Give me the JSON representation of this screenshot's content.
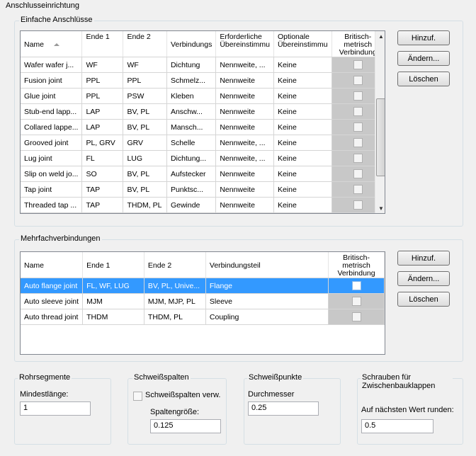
{
  "title": "Anschlusseinrichtung",
  "simple": {
    "title": "Einfache Anschlüsse",
    "columns": [
      "Name",
      "Ende 1",
      "Ende 2",
      "Verbindungs",
      "Erforderliche Übereinstimmu",
      "Optionale Übereinstimmu",
      "Britisch-metrisch Verbindung"
    ],
    "rows": [
      [
        "Wafer wafer j...",
        "WF",
        "WF",
        "Dichtung",
        "Nennweite, ...",
        "Keine"
      ],
      [
        "Fusion joint",
        "PPL",
        "PPL",
        "Schmelz...",
        "Nennweite",
        "Keine"
      ],
      [
        "Glue joint",
        "PPL",
        "PSW",
        "Kleben",
        "Nennweite",
        "Keine"
      ],
      [
        "Stub-end lapp...",
        "LAP",
        "BV, PL",
        "Anschw...",
        "Nennweite",
        "Keine"
      ],
      [
        "Collared lappe...",
        "LAP",
        "BV, PL",
        "Mansch...",
        "Nennweite",
        "Keine"
      ],
      [
        "Grooved joint",
        "PL, GRV",
        "GRV",
        "Schelle",
        "Nennweite, ...",
        "Keine"
      ],
      [
        "Lug joint",
        "FL",
        "LUG",
        "Dichtung...",
        "Nennweite, ...",
        "Keine"
      ],
      [
        "Slip on weld jo...",
        "SO",
        "BV, PL",
        "Aufstecker",
        "Nennweite",
        "Keine"
      ],
      [
        "Tap joint",
        "TAP",
        "BV, PL",
        "Punktsc...",
        "Nennweite",
        "Keine"
      ],
      [
        "Threaded tap ...",
        "TAP",
        "THDM, PL",
        "Gewinde",
        "Nennweite",
        "Keine"
      ]
    ],
    "buttons": {
      "add": "Hinzuf.",
      "edit": "Ändern...",
      "delete": "Löschen"
    }
  },
  "multi": {
    "title": "Mehrfachverbindungen",
    "columns": [
      "Name",
      "Ende 1",
      "Ende 2",
      "Verbindungsteil",
      "Britisch-metrisch Verbindung"
    ],
    "rows": [
      [
        "Auto flange joint",
        "FL, WF, LUG",
        "BV, PL, Unive...",
        "Flange"
      ],
      [
        "Auto sleeve joint",
        "MJM",
        "MJM, MJP, PL",
        "Sleeve"
      ],
      [
        "Auto thread joint",
        "THDM",
        "THDM, PL",
        "Coupling"
      ]
    ],
    "selected_row": 0,
    "buttons": {
      "add": "Hinzuf.",
      "edit": "Ändern...",
      "delete": "Löschen"
    }
  },
  "pipe": {
    "title": "Rohrsegmente",
    "label": "Mindestlänge:",
    "value": "1"
  },
  "gaps": {
    "title": "Schweißspalten",
    "checkbox_label": "Schweißspalten verw.",
    "label": "Spaltengröße:",
    "value": "0.125"
  },
  "points": {
    "title": "Schweißpunkte",
    "label": "Durchmesser",
    "value": "0.25"
  },
  "bolts": {
    "title": "Schrauben für Zwischenbauklappen",
    "label": "Auf nächsten Wert runden:",
    "value": "0.5"
  }
}
